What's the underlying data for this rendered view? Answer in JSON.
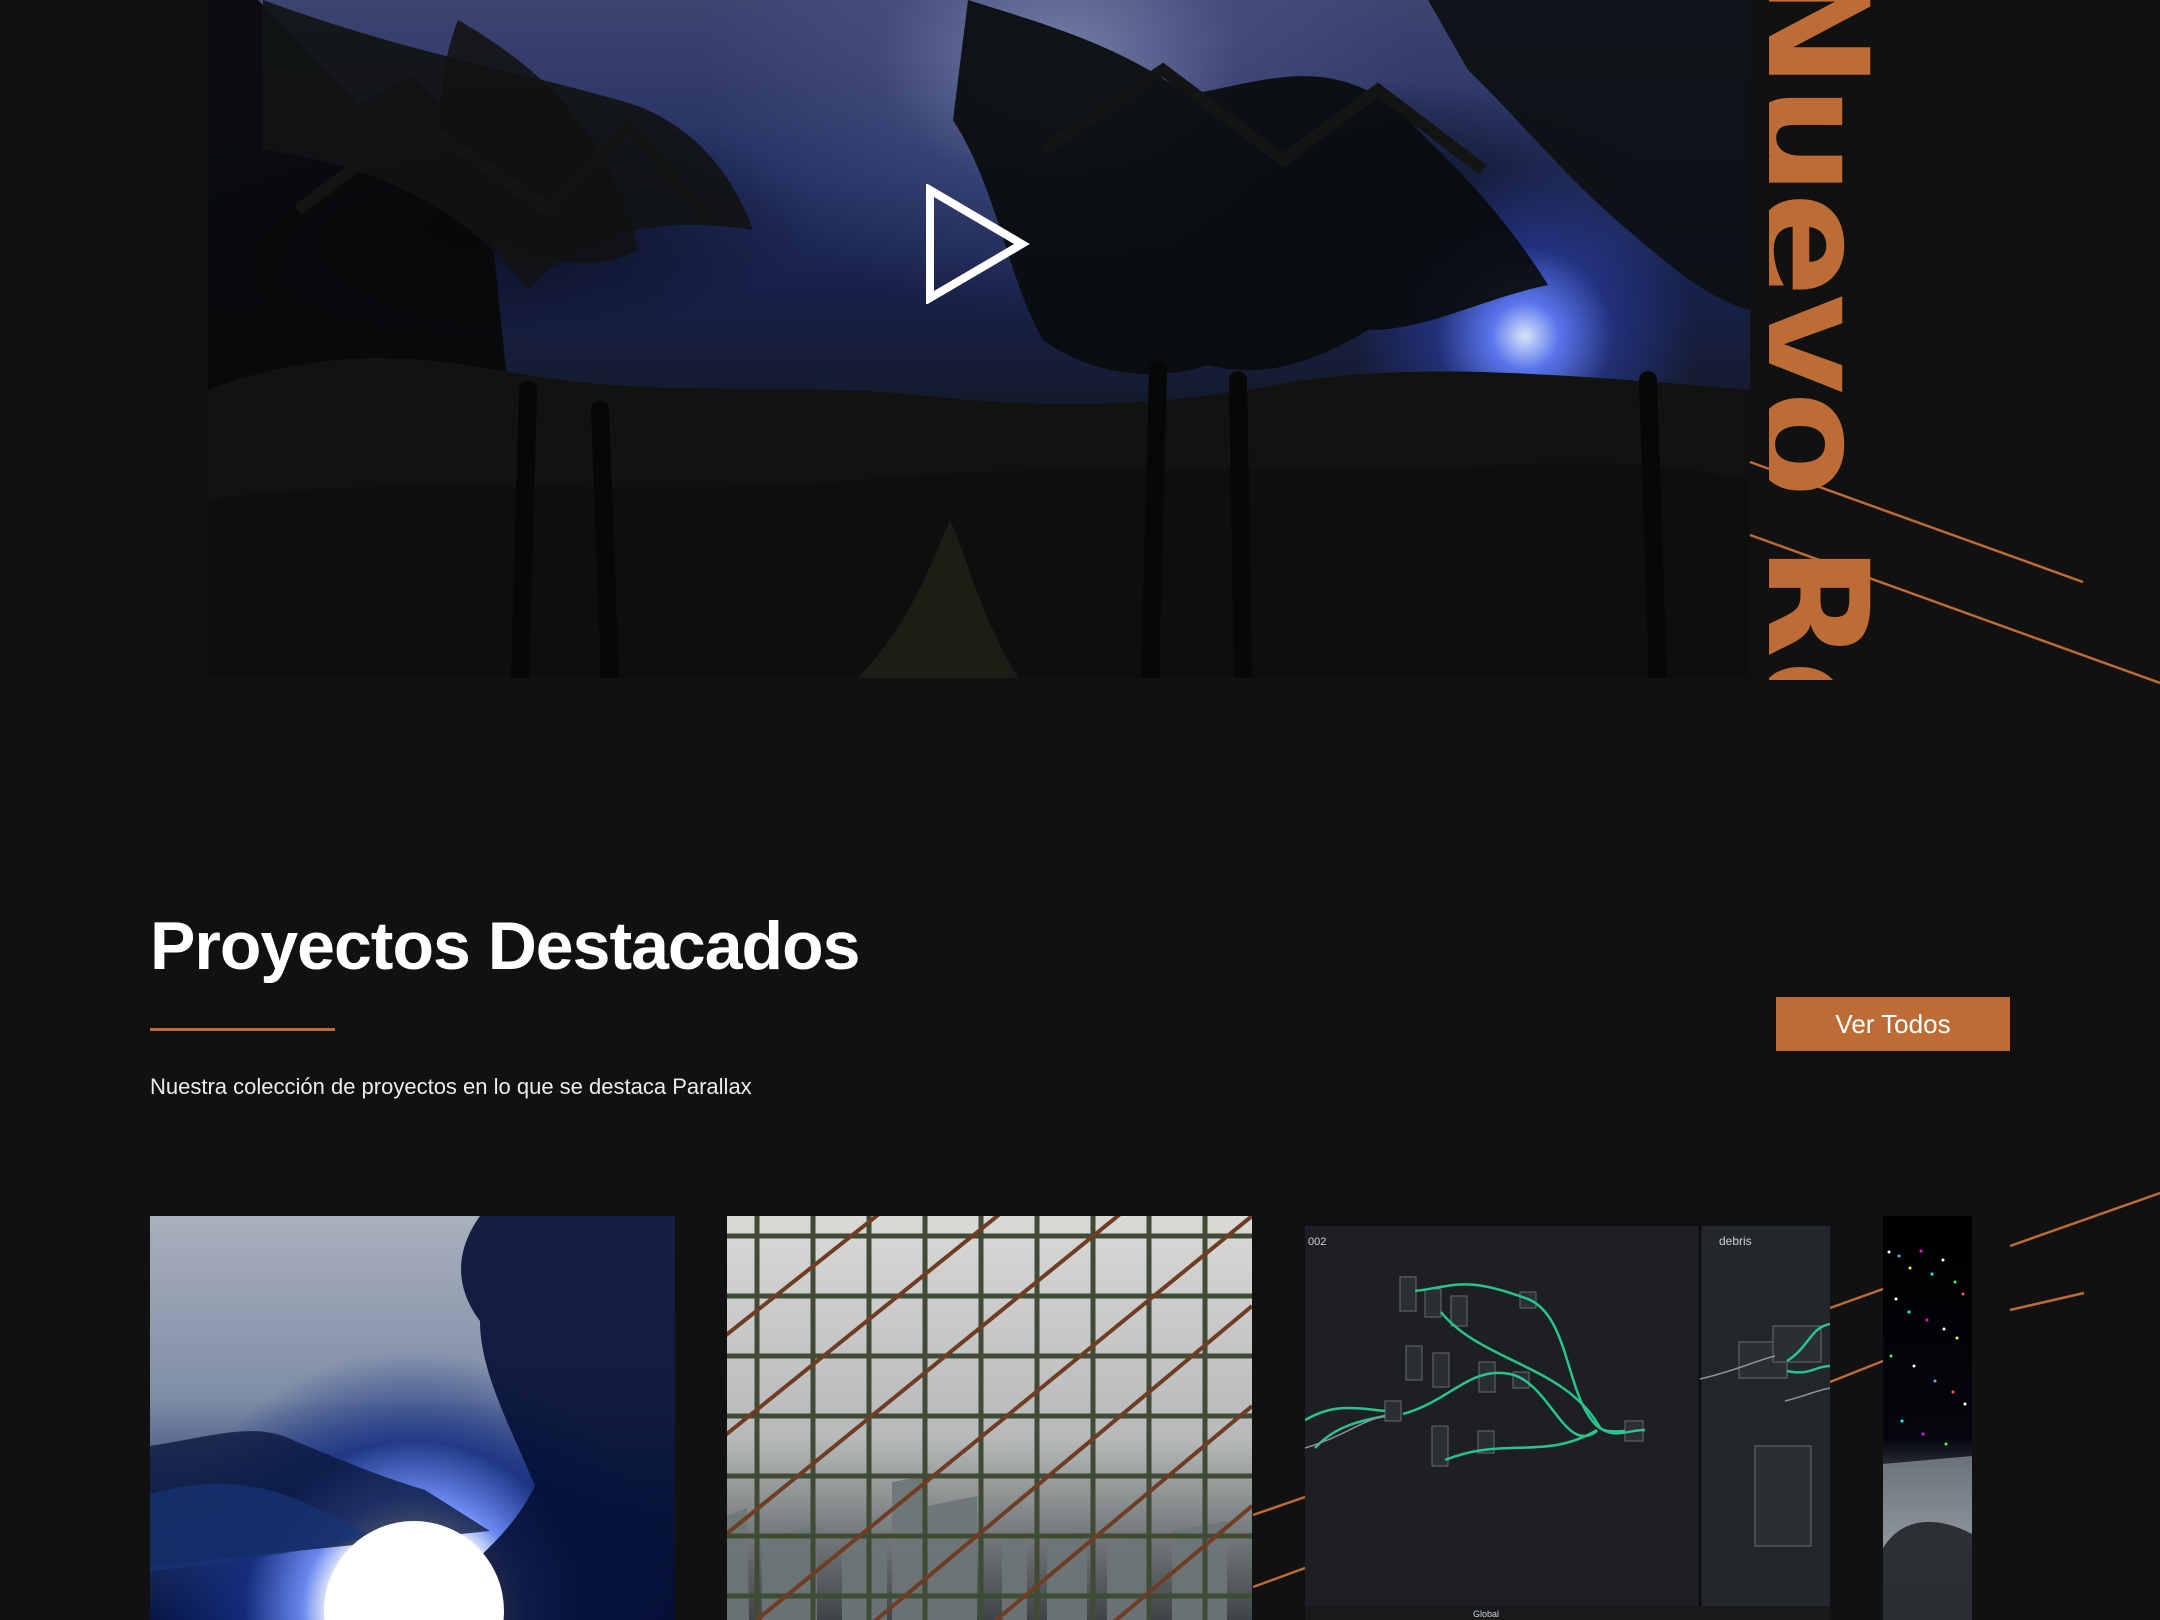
{
  "hero": {
    "vertical_title": "Nuevo Reel",
    "play_icon": "play-icon"
  },
  "projects": {
    "title": "Proyectos Destacados",
    "subtitle": "Nuestra colección de proyectos en lo que se destaca Parallax",
    "view_all_label": "Ver Todos",
    "cards": [
      {
        "thumbnail": "forest-light-orb"
      },
      {
        "thumbnail": "city-through-grid"
      },
      {
        "thumbnail": "node-editor",
        "visible_labels": [
          "002",
          "debris",
          "Global"
        ]
      },
      {
        "thumbnail": "particles"
      }
    ]
  },
  "colors": {
    "background": "#111111",
    "accent": "#bd6c35",
    "text": "#ffffff"
  }
}
